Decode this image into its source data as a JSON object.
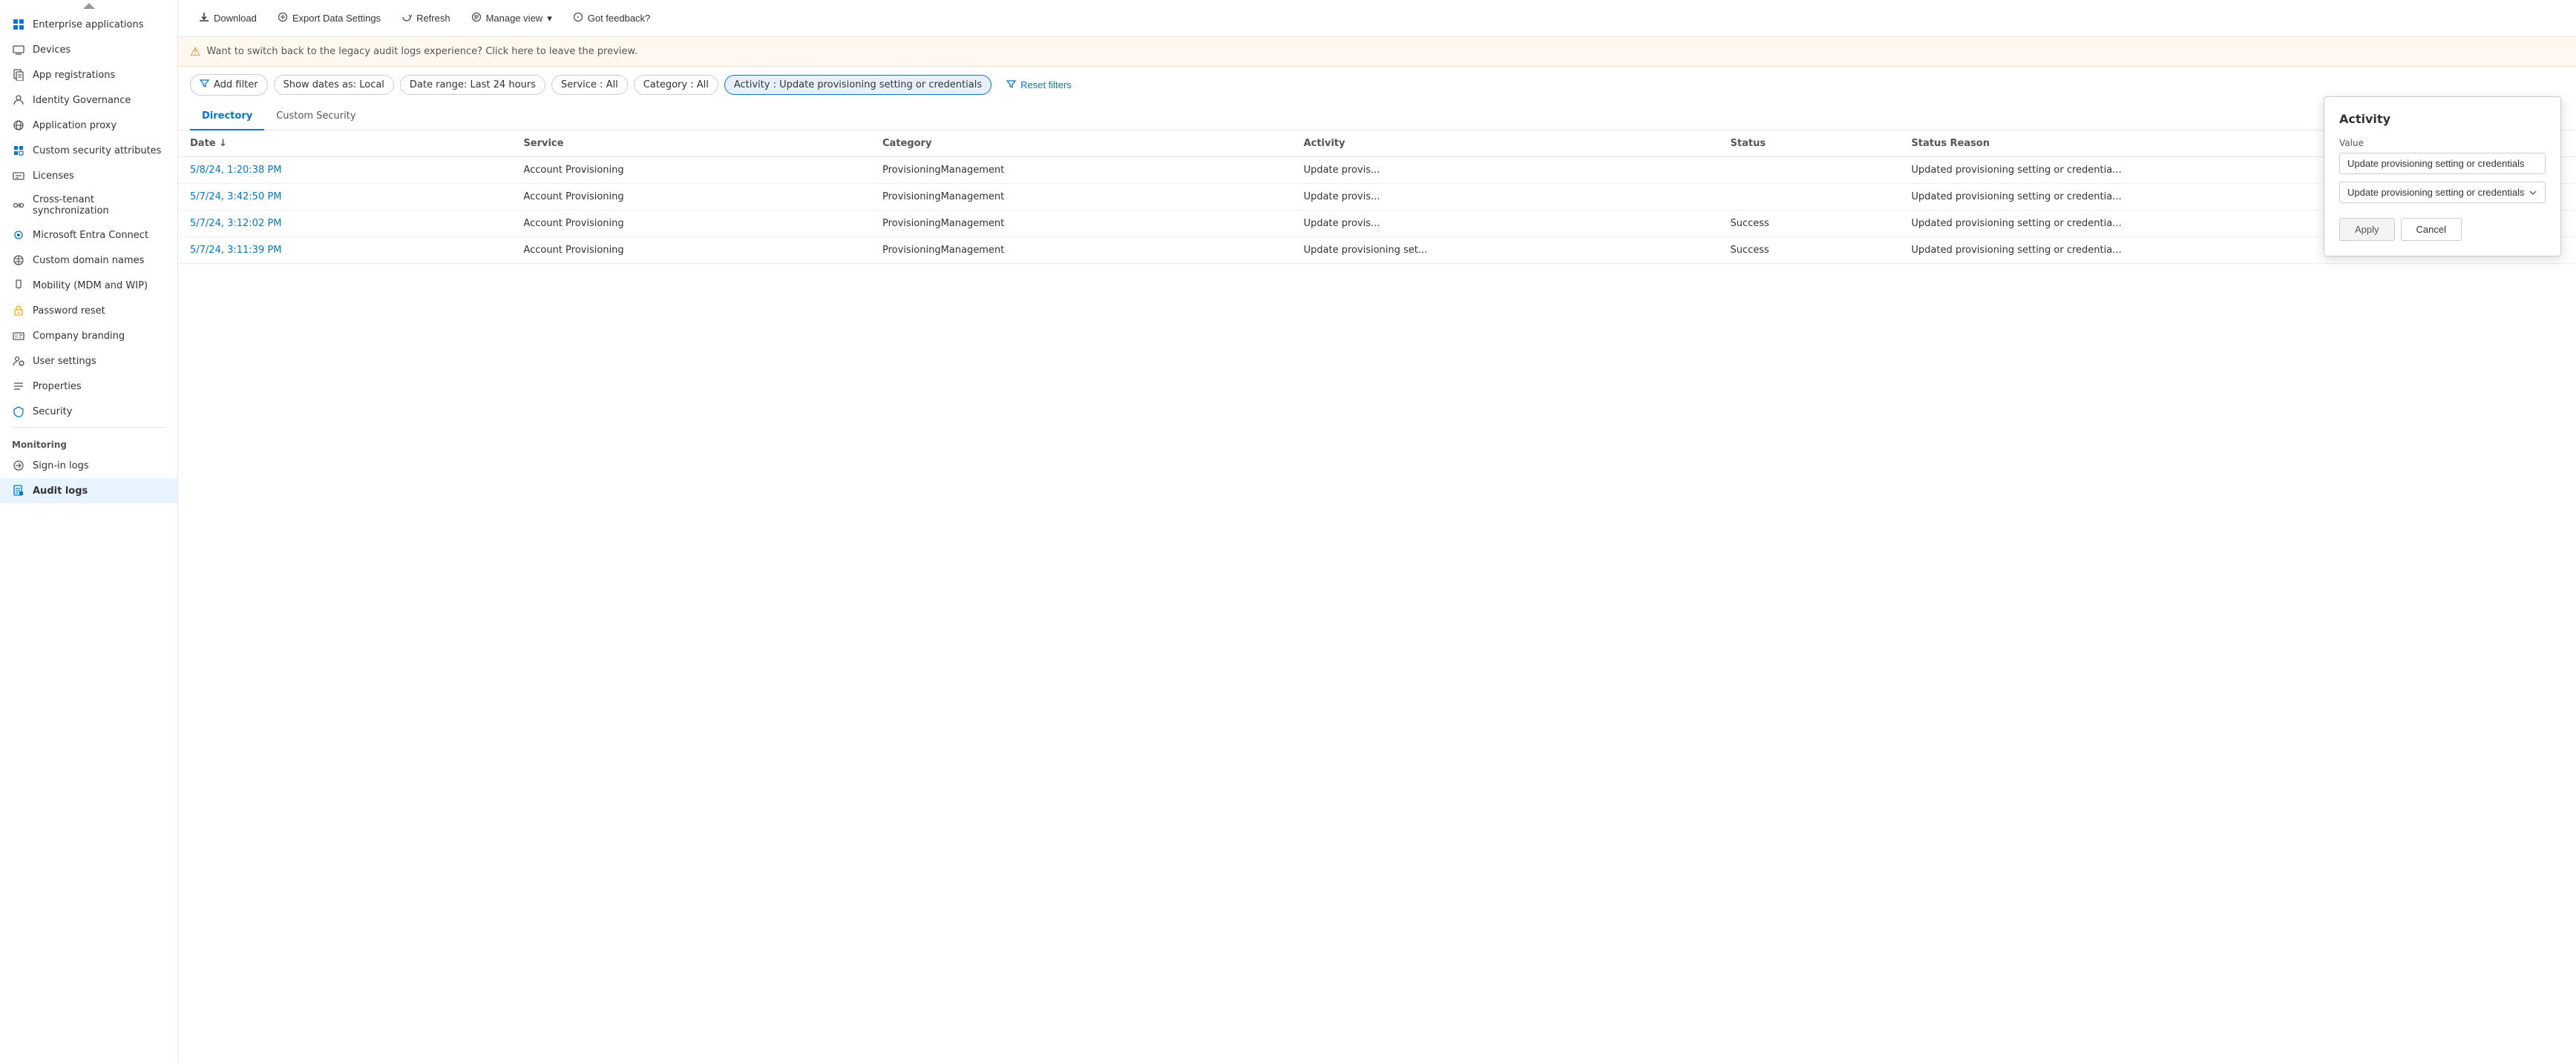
{
  "sidebar": {
    "collapse_label": "«",
    "items": [
      {
        "id": "enterprise-applications",
        "label": "Enterprise applications",
        "icon": "grid-icon"
      },
      {
        "id": "devices",
        "label": "Devices",
        "icon": "device-icon"
      },
      {
        "id": "app-registrations",
        "label": "App registrations",
        "icon": "app-reg-icon"
      },
      {
        "id": "identity-governance",
        "label": "Identity Governance",
        "icon": "id-gov-icon"
      },
      {
        "id": "application-proxy",
        "label": "Application proxy",
        "icon": "app-proxy-icon"
      },
      {
        "id": "custom-security-attributes",
        "label": "Custom security attributes",
        "icon": "custom-sec-icon"
      },
      {
        "id": "licenses",
        "label": "Licenses",
        "icon": "license-icon"
      },
      {
        "id": "cross-tenant-synchronization",
        "label": "Cross-tenant synchronization",
        "icon": "cross-tenant-icon"
      },
      {
        "id": "microsoft-entra-connect",
        "label": "Microsoft Entra Connect",
        "icon": "entra-connect-icon"
      },
      {
        "id": "custom-domain-names",
        "label": "Custom domain names",
        "icon": "domain-icon"
      },
      {
        "id": "mobility-mdm-wip",
        "label": "Mobility (MDM and WIP)",
        "icon": "mobility-icon"
      },
      {
        "id": "password-reset",
        "label": "Password reset",
        "icon": "password-icon"
      },
      {
        "id": "company-branding",
        "label": "Company branding",
        "icon": "branding-icon"
      },
      {
        "id": "user-settings",
        "label": "User settings",
        "icon": "user-settings-icon"
      },
      {
        "id": "properties",
        "label": "Properties",
        "icon": "properties-icon"
      },
      {
        "id": "security",
        "label": "Security",
        "icon": "security-icon"
      }
    ],
    "monitoring_section": "Monitoring",
    "monitoring_items": [
      {
        "id": "sign-in-logs",
        "label": "Sign-in logs",
        "icon": "signin-icon"
      },
      {
        "id": "audit-logs",
        "label": "Audit logs",
        "icon": "audit-icon",
        "active": true
      }
    ]
  },
  "toolbar": {
    "download_label": "Download",
    "export_label": "Export Data Settings",
    "refresh_label": "Refresh",
    "manage_view_label": "Manage view",
    "feedback_label": "Got feedback?"
  },
  "banner": {
    "text": "Want to switch back to the legacy audit logs experience? Click here to leave the preview."
  },
  "filters": {
    "add_filter_label": "Add filter",
    "show_dates_label": "Show dates as: Local",
    "date_range_label": "Date range: Last 24 hours",
    "service_label": "Service : All",
    "category_label": "Category : All",
    "activity_label": "Activity : Update provisioning setting or credentials",
    "reset_filters_label": "Reset filters"
  },
  "tabs": [
    {
      "id": "directory",
      "label": "Directory",
      "active": true
    },
    {
      "id": "custom-security",
      "label": "Custom Security",
      "active": false
    }
  ],
  "table": {
    "columns": [
      "Date ↓",
      "Service",
      "Category",
      "Activity",
      "Status",
      "Status Reason"
    ],
    "rows": [
      {
        "date": "5/8/24, 1:20:38 PM",
        "service": "Account Provisioning",
        "category": "ProvisioningManagement",
        "activity": "Update provis...",
        "status": "",
        "status_reason": "Updated provisioning setting or credentia..."
      },
      {
        "date": "5/7/24, 3:42:50 PM",
        "service": "Account Provisioning",
        "category": "ProvisioningManagement",
        "activity": "Update provis...",
        "status": "",
        "status_reason": "Updated provisioning setting or credentia..."
      },
      {
        "date": "5/7/24, 3:12:02 PM",
        "service": "Account Provisioning",
        "category": "ProvisioningManagement",
        "activity": "Update provis...",
        "status": "Success",
        "status_reason": "Updated provisioning setting or credentia..."
      },
      {
        "date": "5/7/24, 3:11:39 PM",
        "service": "Account Provisioning",
        "category": "ProvisioningManagement",
        "activity": "Update provisioning set...",
        "status": "Success",
        "status_reason": "Updated provisioning setting or credentia..."
      }
    ]
  },
  "popup": {
    "title": "Activity",
    "value_label": "Value",
    "input_value": "Update provisioning setting or credentials",
    "dropdown_value": "Update provisioning setting or credentials",
    "apply_label": "Apply",
    "cancel_label": "Cancel"
  }
}
